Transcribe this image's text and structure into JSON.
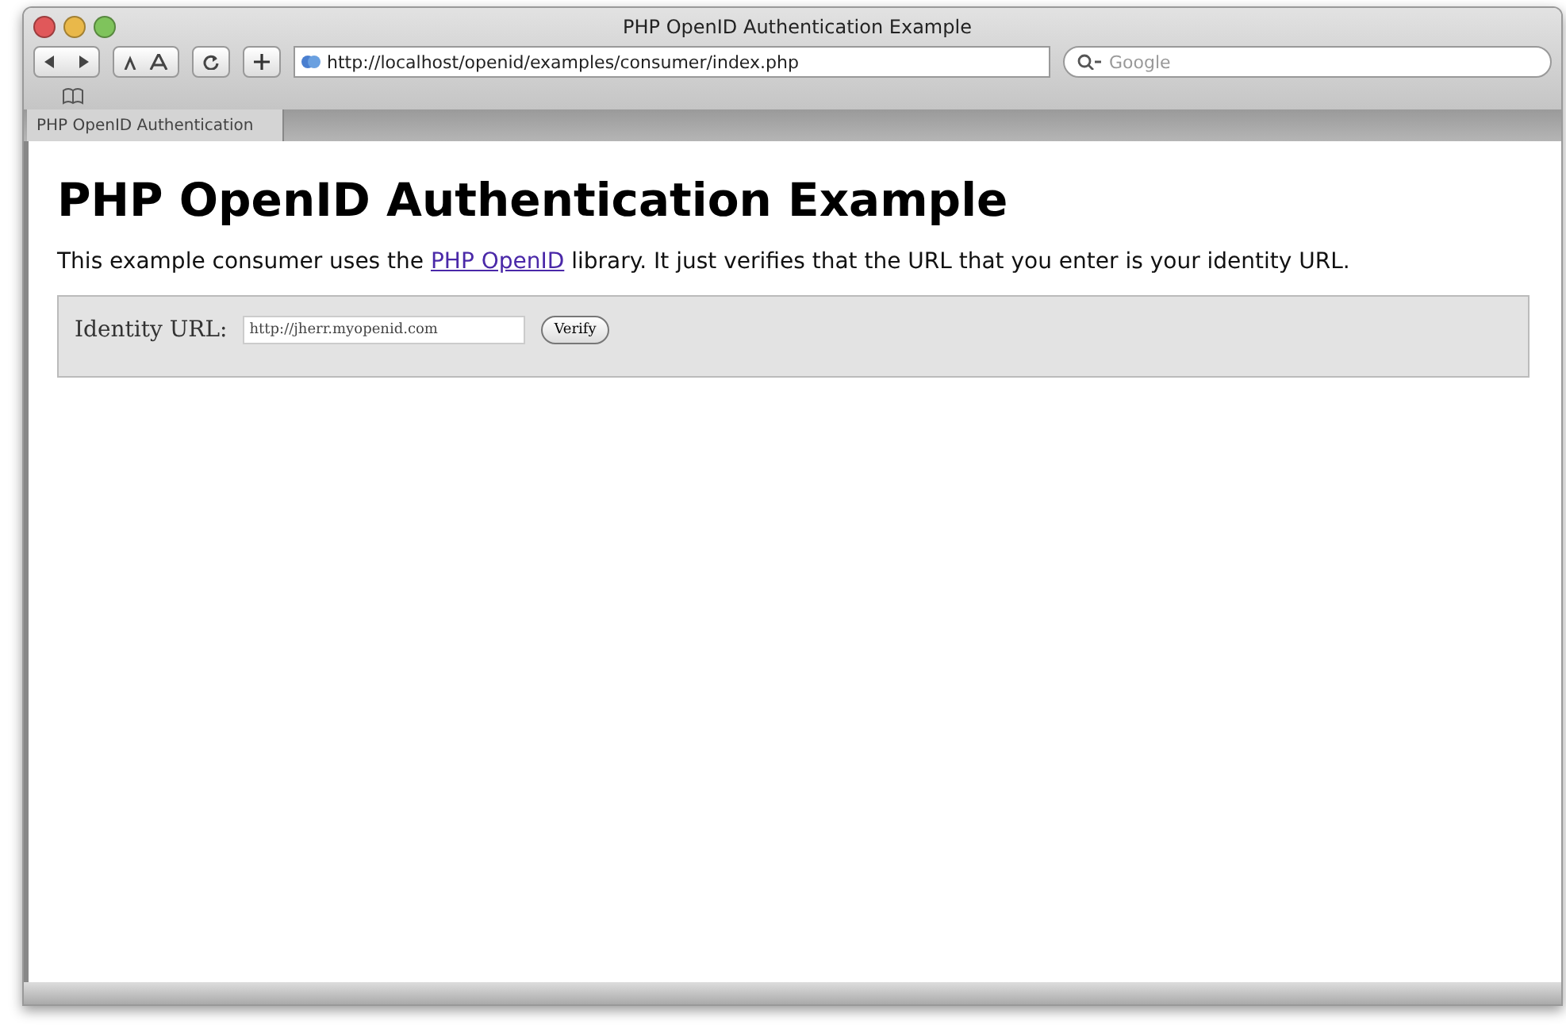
{
  "window": {
    "title": "PHP OpenID Authentication Example"
  },
  "toolbar": {
    "address": "http://localhost/openid/examples/consumer/index.php",
    "search": {
      "placeholder": "Google"
    }
  },
  "tabs": [
    {
      "label": "PHP OpenID Authentication",
      "selected": true
    }
  ],
  "page": {
    "heading": "PHP OpenID Authentication Example",
    "intro": {
      "before": "This example consumer uses the ",
      "link": "PHP OpenID",
      "after": " library. It just verifies that the URL that you enter is your identity URL."
    },
    "form": {
      "label": "Identity URL:",
      "value": "http://jherr.myopenid.com",
      "button": "Verify"
    }
  }
}
